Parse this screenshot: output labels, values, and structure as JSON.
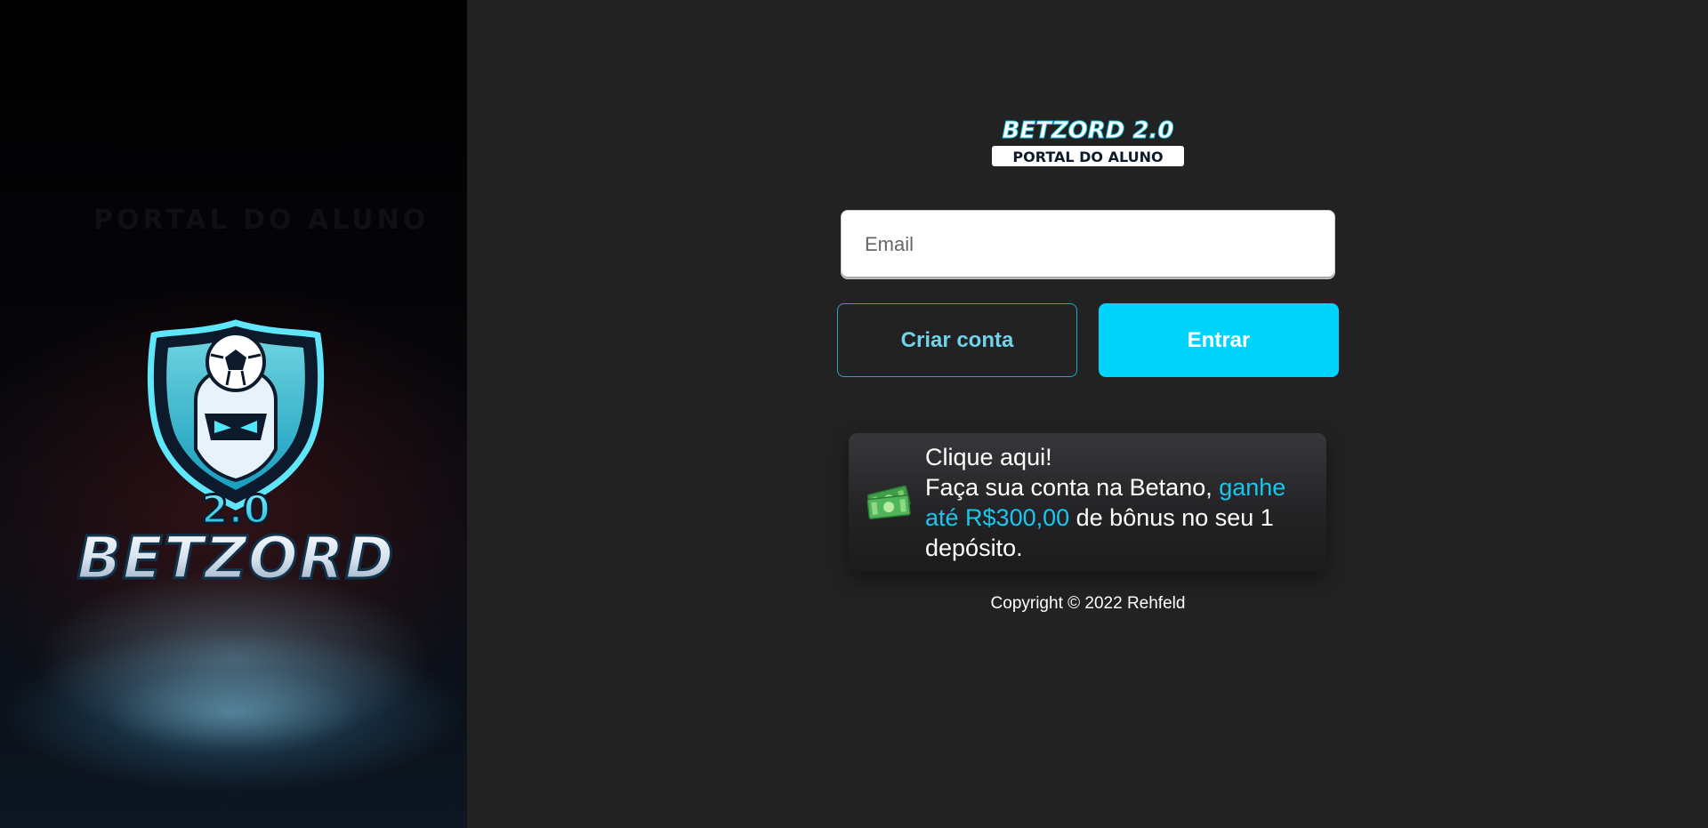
{
  "hero": {
    "logo_text": "BETZORD",
    "logo_version": "2.0",
    "faint_text": "PORTAL DO ALUNO"
  },
  "brand": {
    "name": "BETZORD 2.0",
    "subtitle": "PORTAL DO ALUNO"
  },
  "login": {
    "email_placeholder": "Email",
    "email_value": "",
    "create_account_label": "Criar conta",
    "sign_in_label": "Entrar"
  },
  "promo": {
    "icon": "money-icon",
    "line1": "Clique aqui!",
    "line2_prefix": "Faça sua conta na Betano, ",
    "line2_highlight": "ganhe até R$300,00",
    "line2_suffix": " de bônus no seu 1 depósito."
  },
  "footer": {
    "copyright": "Copyright © 2022 Rehfeld"
  },
  "colors": {
    "background": "#222222",
    "accent": "#00d4fb",
    "accent_border": "#1ea8c9",
    "highlight_text": "#18c6ee"
  }
}
